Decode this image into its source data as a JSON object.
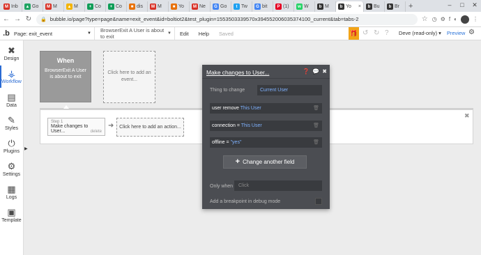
{
  "browser": {
    "tabs": [
      {
        "label": "Inb",
        "icon": "gmail-icon",
        "color": "#d93025",
        "letter": "M"
      },
      {
        "label": "Go",
        "icon": "drive-icon",
        "color": "#1fa463",
        "letter": "▲"
      },
      {
        "label": "M",
        "icon": "gmail-icon",
        "color": "#d93025",
        "letter": "M"
      },
      {
        "label": "M",
        "icon": "drive-icon",
        "color": "#f4b400",
        "letter": "▲"
      },
      {
        "label": "Co",
        "icon": "sheets-icon",
        "color": "#0f9d58",
        "letter": "+"
      },
      {
        "label": "Co",
        "icon": "sheets-icon",
        "color": "#0f9d58",
        "letter": "+"
      },
      {
        "label": "dis",
        "icon": "bubble-icon",
        "color": "#e8710a",
        "letter": "■"
      },
      {
        "label": "M",
        "icon": "gmail-icon",
        "color": "#d93025",
        "letter": "M"
      },
      {
        "label": "Yo",
        "icon": "bubble-icon",
        "color": "#e8710a",
        "letter": "■"
      },
      {
        "label": "Ne",
        "icon": "gmail-icon",
        "color": "#d93025",
        "letter": "M"
      },
      {
        "label": "Go",
        "icon": "google-icon",
        "color": "#4285f4",
        "letter": "G"
      },
      {
        "label": "Tw",
        "icon": "twitter-icon",
        "color": "#1da1f2",
        "letter": "t"
      },
      {
        "label": "bit",
        "icon": "google-icon",
        "color": "#4285f4",
        "letter": "G"
      },
      {
        "label": "(1)",
        "icon": "pinterest-icon",
        "color": "#e60023",
        "letter": "P"
      },
      {
        "label": "W",
        "icon": "whatsapp-icon",
        "color": "#25d366",
        "letter": "w"
      },
      {
        "label": "M",
        "icon": "bubble-icon",
        "color": "#333333",
        "letter": "b"
      },
      {
        "label": "Yo",
        "icon": "bubble-icon",
        "color": "#333333",
        "letter": "b"
      },
      {
        "label": "Bu",
        "icon": "bubble-icon",
        "color": "#333333",
        "letter": "b"
      },
      {
        "label": "Br",
        "icon": "bubble-icon",
        "color": "#333333",
        "letter": "b"
      }
    ],
    "url": "bubble.io/page?type=page&name=exit_event&id=boltiot2&test_plugin=1553503339570x394552006035374100_current&tab=tabs-2"
  },
  "topbar": {
    "page_label": "Page: exit_event",
    "element_label": "BrowserExit A User is about to exit",
    "menu": [
      "Edit",
      "Help"
    ],
    "saved": "Saved",
    "dev_label": "Deve (read-only)",
    "preview_label": "Preview"
  },
  "sidebar": {
    "items": [
      {
        "label": "Design",
        "icon": "design-icon"
      },
      {
        "label": "Workflow",
        "icon": "workflow-icon"
      },
      {
        "label": "Data",
        "icon": "data-icon"
      },
      {
        "label": "Styles",
        "icon": "styles-icon"
      },
      {
        "label": "Plugins",
        "icon": "plugins-icon"
      },
      {
        "label": "Settings",
        "icon": "settings-icon"
      },
      {
        "label": "Logs",
        "icon": "logs-icon"
      },
      {
        "label": "Template",
        "icon": "template-icon"
      }
    ]
  },
  "workflow": {
    "when_title": "When",
    "when_desc": "BrowserExit A User is about to exit",
    "add_event": "Click here to add an event...",
    "step_label": "Step 1",
    "step_title": "Make changes to User...",
    "step_delete": "delete",
    "add_action": "Click here to add an action..."
  },
  "modal": {
    "title": "Make changes to User...",
    "thing_label": "Thing to change",
    "thing_value": "Current User",
    "changes": [
      {
        "field": "user remove",
        "op": "",
        "value": "This User"
      },
      {
        "field": "connection",
        "op": "=",
        "value": "This User"
      },
      {
        "field": "offline",
        "op": "=",
        "value": "\"yes\""
      }
    ],
    "change_button": "Change another field",
    "only_when_label": "Only when",
    "only_when_placeholder": "Click",
    "breakpoint_label": "Add a breakpoint in debug mode"
  }
}
